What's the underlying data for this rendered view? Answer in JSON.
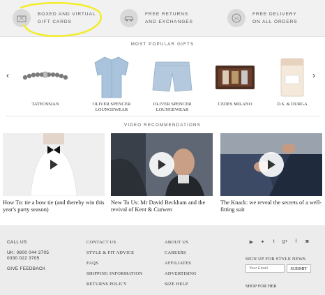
{
  "benefits": [
    {
      "line1": "BOXED AND VIRTUAL",
      "line2": "GIFT CARDS",
      "icon": "gift-card-icon"
    },
    {
      "line1": "FREE RETURNS",
      "line2": "AND EXCHANGES",
      "icon": "car-icon"
    },
    {
      "line1": "FREE DELIVERY",
      "line2": "ON ALL ORDERS",
      "icon": "24-hour-icon"
    }
  ],
  "highlight_color": "#f2ec2a",
  "gifts": {
    "title": "MOST POPULAR GIFTS",
    "items": [
      {
        "label": "TATEOSSIAN",
        "label2": ""
      },
      {
        "label": "OLIVER SPENCER",
        "label2": "LOUNGEWEAR"
      },
      {
        "label": "OLIVER SPENCER",
        "label2": "LOUNGEWEAR"
      },
      {
        "label": "CEDES MILANO",
        "label2": ""
      },
      {
        "label": "D.S. & DURGA",
        "label2": ""
      }
    ]
  },
  "videos": {
    "title": "VIDEO RECOMMENDATIONS",
    "items": [
      {
        "caption": "How To: tie a bow tie (and thereby win this year's party season)"
      },
      {
        "caption": "New To Us: Mr David Beckham and the revival of Kent & Curwen"
      },
      {
        "caption": "The Knack: we reveal the secrets of a well-fitting suit"
      }
    ]
  },
  "footer": {
    "call": {
      "title": "CALL US",
      "uk": "UK: 0800 044 3705",
      "alt": "0330 022 3705",
      "feedback": "GIVE FEEDBACK"
    },
    "col2": [
      "CONTACT US",
      "STYLE & FIT ADVICE",
      "FAQS",
      "SHIPPING INFORMATION",
      "RETURNS POLICY"
    ],
    "col3": [
      "ABOUT US",
      "CAREERS",
      "AFFILIATES",
      "ADVERTISING",
      "SIZE HELP"
    ],
    "social": [
      {
        "glyph": "▶",
        "icon": "youtube-icon"
      },
      {
        "glyph": "✦",
        "icon": "twitter-icon"
      },
      {
        "glyph": "t",
        "icon": "tumblr-icon"
      },
      {
        "glyph": "g+",
        "icon": "google-plus-icon"
      },
      {
        "glyph": "f",
        "icon": "facebook-icon"
      },
      {
        "glyph": "◙",
        "icon": "instagram-icon"
      }
    ],
    "newsletter_label": "SIGN UP FOR STYLE NEWS",
    "email_placeholder": "Your Email",
    "submit_label": "SUBMIT",
    "shop_for_her": "SHOP FOR HER"
  }
}
